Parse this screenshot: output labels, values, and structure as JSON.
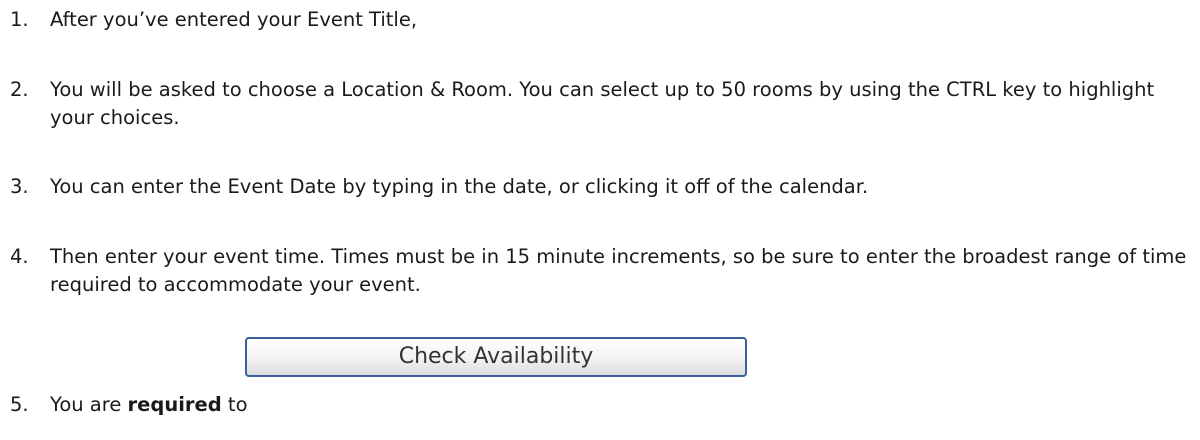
{
  "instructions": [
    {
      "number": "1.",
      "text": "After you’ve entered your Event Title,"
    },
    {
      "number": "2.",
      "text": "You will be asked to choose a Location & Room.  You can select up to 50 rooms by using the CTRL key to highlight your choices."
    },
    {
      "number": "3.",
      "text": "You can enter the Event Date by typing in the date, or clicking it off of the calendar."
    },
    {
      "number": "4.",
      "text": "Then enter your event time.  Times must be in 15 minute increments, so be sure to enter the broadest range of time required to accommodate your event."
    },
    {
      "number": "5.",
      "text_before": "You are ",
      "text_bold": "required",
      "text_after": " to"
    }
  ],
  "check_availability_button": {
    "label": "Check Availability"
  }
}
